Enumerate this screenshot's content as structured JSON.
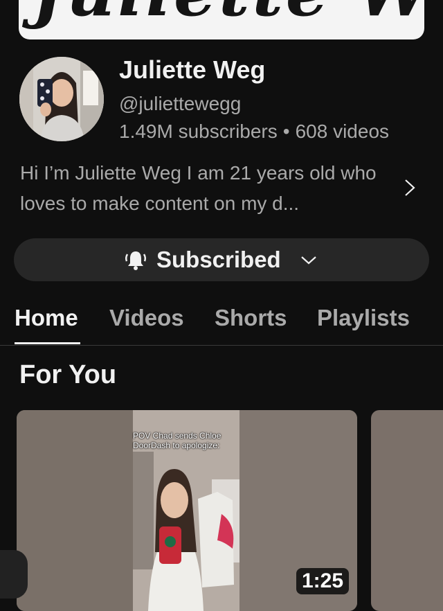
{
  "banner": {
    "text": "Juliette Weg"
  },
  "channel": {
    "name": "Juliette Weg",
    "handle": "@juliettewegg",
    "subscribers": "1.49M subscribers",
    "separator": "•",
    "videos": "608 videos",
    "description": "Hi I’m Juliette Weg I am 21 years old who loves to make content on my d..."
  },
  "subscribe": {
    "label": "Subscribed",
    "icon": "bell-ringing-icon",
    "chevron": "chevron-down-icon"
  },
  "tabs": [
    {
      "label": "Home",
      "active": true
    },
    {
      "label": "Videos",
      "active": false
    },
    {
      "label": "Shorts",
      "active": false
    },
    {
      "label": "Playlists",
      "active": false
    }
  ],
  "section": {
    "title": "For You"
  },
  "video": {
    "overlay_text": "POV Chad sends Chloe DoorDash to apologize:",
    "duration": "1:25"
  },
  "colors": {
    "background": "#0f0f0f",
    "text_primary": "#f1f1f1",
    "text_secondary": "#aaaaaa",
    "button_bg": "#272727"
  }
}
